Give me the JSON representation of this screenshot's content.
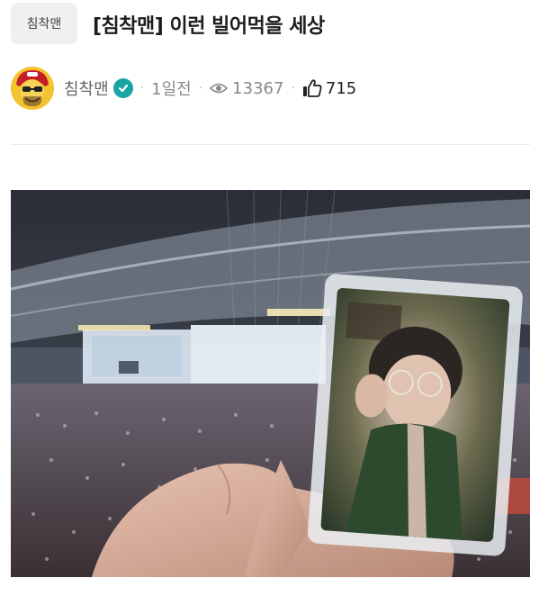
{
  "post": {
    "category": "침착맨",
    "title": "[침착맨] 이런 빌어먹을 세상",
    "author": "침착맨",
    "time_ago": "1일전",
    "views": "13367",
    "likes": "715"
  },
  "icons": {
    "verified": "verified-check-icon",
    "views": "eye-icon",
    "likes": "thumbs-up-icon"
  },
  "colors": {
    "verified": "#19a5a4",
    "tag_bg": "#f0f0f2"
  }
}
